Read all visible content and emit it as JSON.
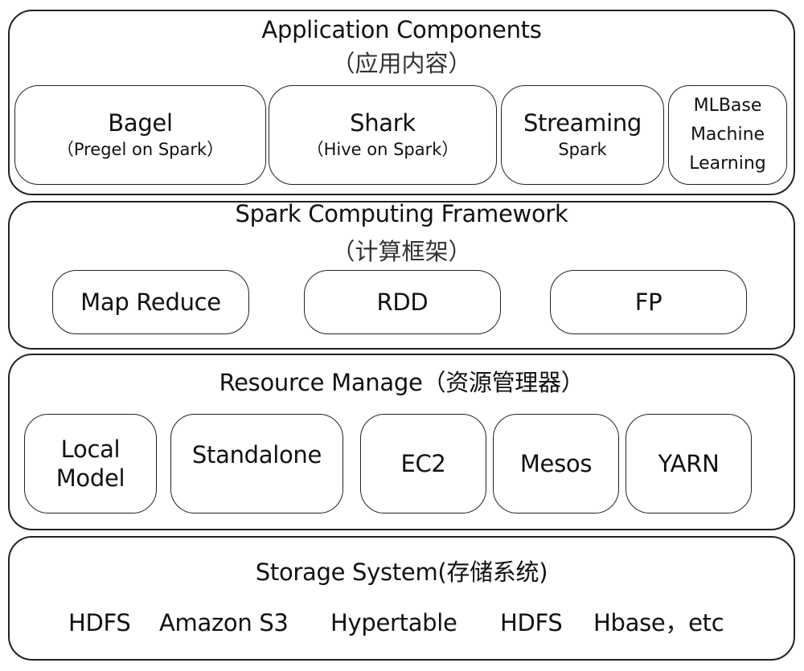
{
  "layers": {
    "application": {
      "title": "Application Components",
      "subtitle": "（应用内容）",
      "components": [
        {
          "name": "Bagel",
          "note": "（Pregel on Spark）"
        },
        {
          "name": "Shark",
          "note": "（Hive on Spark）"
        },
        {
          "name": "Streaming",
          "note": "Spark"
        },
        {
          "lines": [
            "MLBase",
            "Machine",
            "Learning"
          ]
        }
      ]
    },
    "computing": {
      "title": "Spark Computing Framework",
      "subtitle": "（计算框架）",
      "components": [
        "Map Reduce",
        "RDD",
        "FP"
      ]
    },
    "resource": {
      "title": "Resource Manage（资源管理器）",
      "components": [
        {
          "lines": [
            "Local",
            "Model"
          ]
        },
        {
          "lines": [
            "Standalone"
          ]
        },
        {
          "lines": [
            "EC2"
          ]
        },
        {
          "lines": [
            "Mesos"
          ]
        },
        {
          "lines": [
            "YARN"
          ]
        }
      ]
    },
    "storage": {
      "title": "Storage System(存储系统)",
      "items": [
        "HDFS",
        "Amazon S3",
        "Hypertable",
        "HDFS",
        "Hbase，etc"
      ]
    }
  }
}
